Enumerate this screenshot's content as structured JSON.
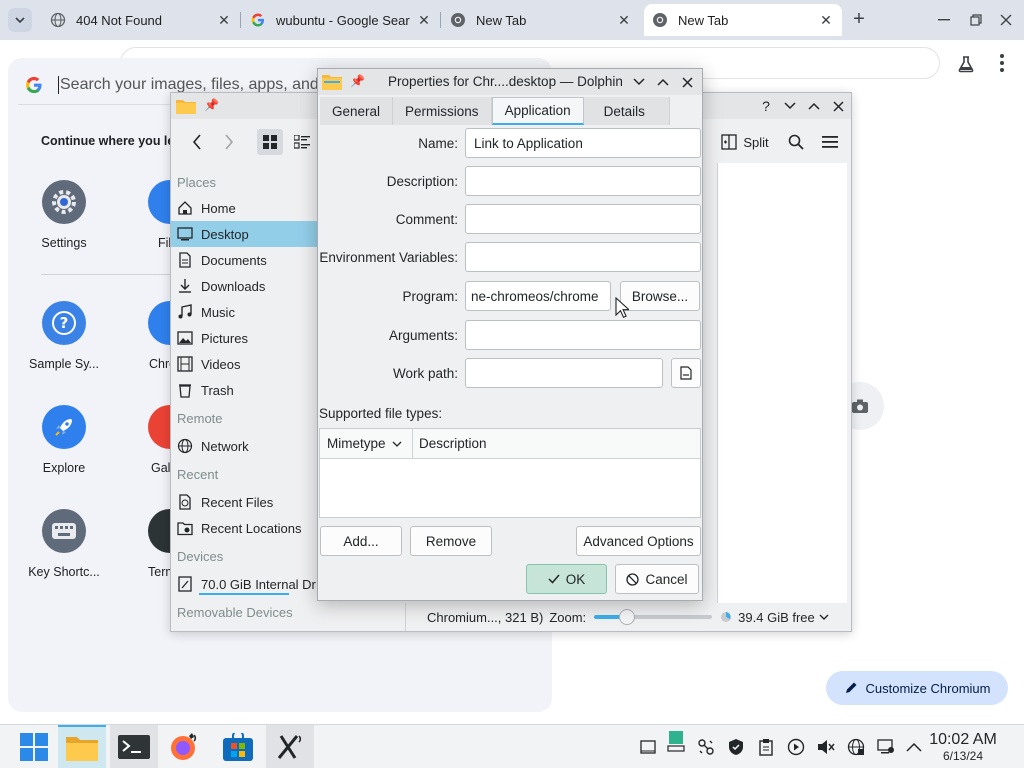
{
  "browser": {
    "tabs": [
      {
        "title": "404 Not Found",
        "active": false
      },
      {
        "title": "wubuntu - Google Sear",
        "active": false
      },
      {
        "title": "New Tab",
        "active": false
      },
      {
        "title": "New Tab",
        "active": true
      }
    ],
    "customize_label": "Customize Chromium"
  },
  "launcher": {
    "search_placeholder": "Search your images, files, apps, and m",
    "continue_label": "Continue where you lef",
    "apps": [
      {
        "label": "Settings"
      },
      {
        "label": "Sample Sy..."
      },
      {
        "label": "Explore"
      },
      {
        "label": "Key Shortc..."
      }
    ],
    "peek_apps": [
      {
        "label": "Fil"
      },
      {
        "label": "Chro"
      },
      {
        "label": "Gal"
      },
      {
        "label": "Term"
      }
    ]
  },
  "dolphin": {
    "split_label": "Split",
    "places_heading": "Places",
    "places": [
      "Home",
      "Desktop",
      "Documents",
      "Downloads",
      "Music",
      "Pictures",
      "Videos",
      "Trash"
    ],
    "remote_heading": "Remote",
    "remote": [
      "Network"
    ],
    "recent_heading": "Recent",
    "recent": [
      "Recent Files",
      "Recent Locations"
    ],
    "devices_heading": "Devices",
    "devices": [
      "70.0 GiB Internal Dr"
    ],
    "removable_heading": "Removable Devices",
    "status": {
      "selection": "Chromium..., 321 B)",
      "zoom_label": "Zoom:",
      "zoom_level": 0.28,
      "free_space": "39.4 GiB free"
    }
  },
  "properties": {
    "title": "Properties for Chr....desktop — Dolphin",
    "tabs": [
      "General",
      "Permissions",
      "Application",
      "Details"
    ],
    "active_tab": "Application",
    "fields": {
      "name_label": "Name:",
      "name_value": "Link to Application",
      "description_label": "Description:",
      "comment_label": "Comment:",
      "env_label": "Environment Variables:",
      "program_label": "Program:",
      "program_value": "ne-chromeos/chrome",
      "browse_label": "Browse...",
      "arguments_label": "Arguments:",
      "workpath_label": "Work path:"
    },
    "supported_label": "Supported file types:",
    "table_headers": {
      "mimetype": "Mimetype",
      "description": "Description"
    },
    "buttons": {
      "add": "Add...",
      "remove": "Remove",
      "advanced": "Advanced Options",
      "ok": "OK",
      "cancel": "Cancel"
    }
  },
  "taskbar": {
    "time": "10:02 AM",
    "date": "6/13/24"
  },
  "colors": {
    "accent": "#3daee9",
    "selection": "#93cee9",
    "ok_button": "#c6e5d8"
  }
}
